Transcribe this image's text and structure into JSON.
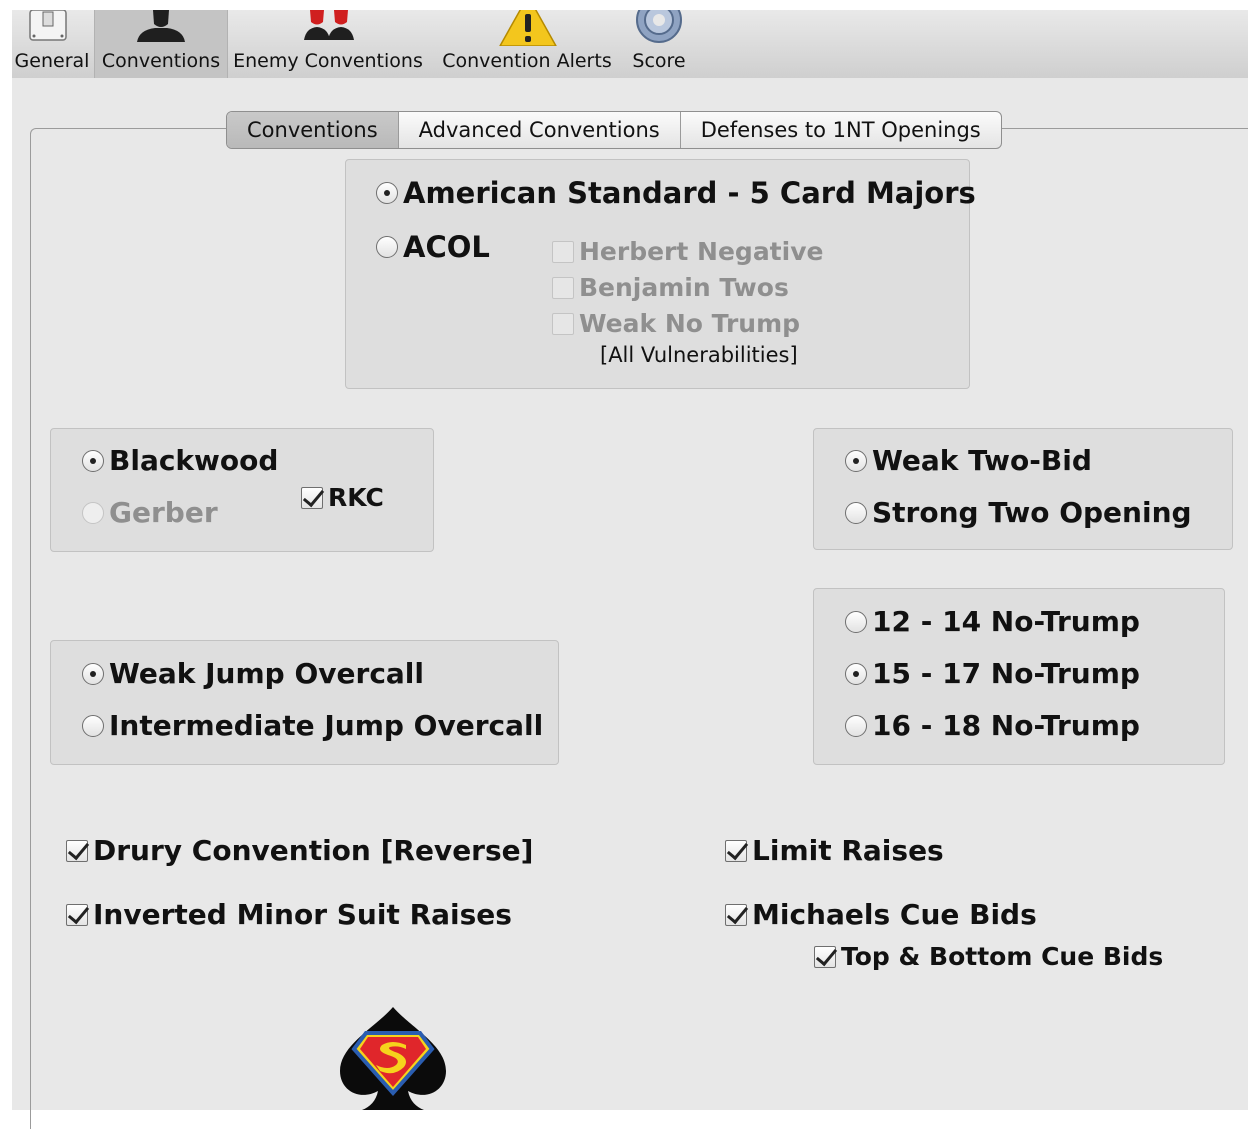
{
  "toolbar": {
    "items": [
      {
        "label": "General",
        "icon": "switch-icon"
      },
      {
        "label": "Conventions",
        "icon": "person-silhouette-icon",
        "selected": true
      },
      {
        "label": "Enemy Conventions",
        "icon": "red-people-icon"
      },
      {
        "label": "Convention Alerts",
        "icon": "warning-icon"
      },
      {
        "label": "Score",
        "icon": "gear-icon"
      }
    ]
  },
  "tabs": [
    {
      "label": "Conventions",
      "active": true
    },
    {
      "label": "Advanced Conventions",
      "active": false
    },
    {
      "label": "Defenses to 1NT Openings",
      "active": false
    }
  ],
  "system": {
    "american": {
      "label": "American Standard - 5 Card Majors",
      "selected": true
    },
    "acol": {
      "label": "ACOL",
      "selected": false
    },
    "acol_options": [
      {
        "label": "Herbert Negative",
        "checked": false,
        "enabled": false
      },
      {
        "label": "Benjamin Twos",
        "checked": false,
        "enabled": false
      },
      {
        "label": "Weak No Trump",
        "checked": false,
        "enabled": false
      }
    ],
    "vulnerability_note": "[All Vulnerabilities]"
  },
  "slam": {
    "blackwood": {
      "label": "Blackwood",
      "selected": true
    },
    "gerber": {
      "label": "Gerber",
      "selected": false,
      "enabled": false
    },
    "rkc": {
      "label": "RKC",
      "checked": true
    }
  },
  "two_bids": {
    "weak": {
      "label": "Weak Two-Bid",
      "selected": true
    },
    "strong": {
      "label": "Strong Two Opening",
      "selected": false
    }
  },
  "notrump": [
    {
      "label": "12 - 14 No-Trump",
      "selected": false
    },
    {
      "label": "15 - 17 No-Trump",
      "selected": true
    },
    {
      "label": "16 - 18 No-Trump",
      "selected": false
    }
  ],
  "overcalls": {
    "weak": {
      "label": "Weak Jump Overcall",
      "selected": true
    },
    "intermediate": {
      "label": "Intermediate Jump Overcall",
      "selected": false
    }
  },
  "checkboxes": {
    "drury": {
      "label": "Drury Convention [Reverse]",
      "checked": true
    },
    "inverted": {
      "label": "Inverted Minor Suit Raises",
      "checked": true
    },
    "limit": {
      "label": "Limit Raises",
      "checked": true
    },
    "michaels": {
      "label": "Michaels Cue Bids",
      "checked": true
    },
    "top_bottom": {
      "label": "Top & Bottom Cue Bids",
      "checked": true
    }
  },
  "logo": {
    "icon": "spade-superman-logo-icon"
  },
  "colors": {
    "logo_red": "#e0262b",
    "logo_yellow": "#f6d31c",
    "logo_blue": "#2a5db0",
    "warning_yellow": "#f3c61d"
  }
}
